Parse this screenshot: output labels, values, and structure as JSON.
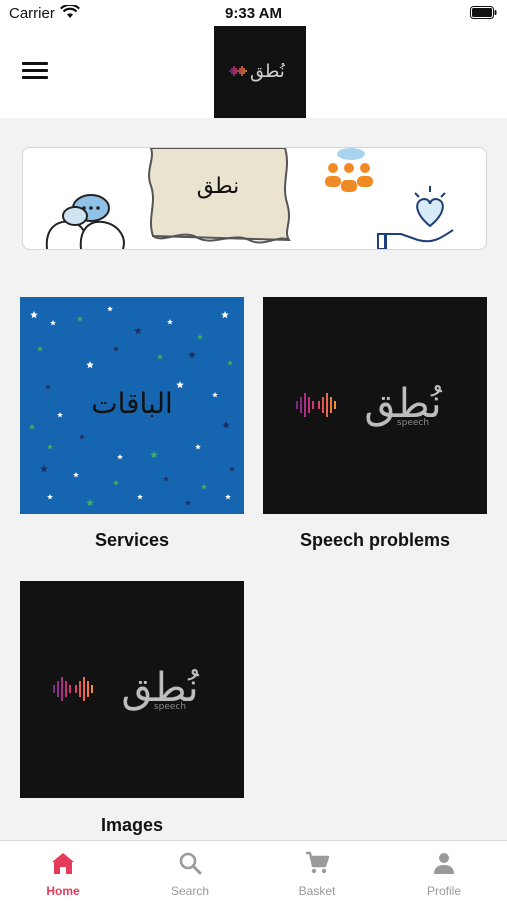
{
  "status_bar": {
    "carrier": "Carrier",
    "time": "9:33 AM"
  },
  "header": {
    "menu_icon": "hamburger-menu-icon"
  },
  "banner": {
    "scroll_text": "نطق"
  },
  "tiles": [
    {
      "label": "Services",
      "image_text": "الباقات"
    },
    {
      "label": "Speech problems",
      "logo_text": "نُطق",
      "logo_sub": "speech"
    },
    {
      "label": "Images",
      "logo_text": "نُطق",
      "logo_sub": "speech"
    }
  ],
  "tabbar": {
    "tabs": [
      {
        "label": "Home",
        "icon": "home-icon",
        "active": true
      },
      {
        "label": "Search",
        "icon": "search-icon",
        "active": false
      },
      {
        "label": "Basket",
        "icon": "cart-icon",
        "active": false
      },
      {
        "label": "Profile",
        "icon": "person-icon",
        "active": false
      }
    ]
  },
  "colors": {
    "accent": "#e63a5a",
    "services_bg": "#1565b0",
    "logo_bg": "#121212"
  }
}
